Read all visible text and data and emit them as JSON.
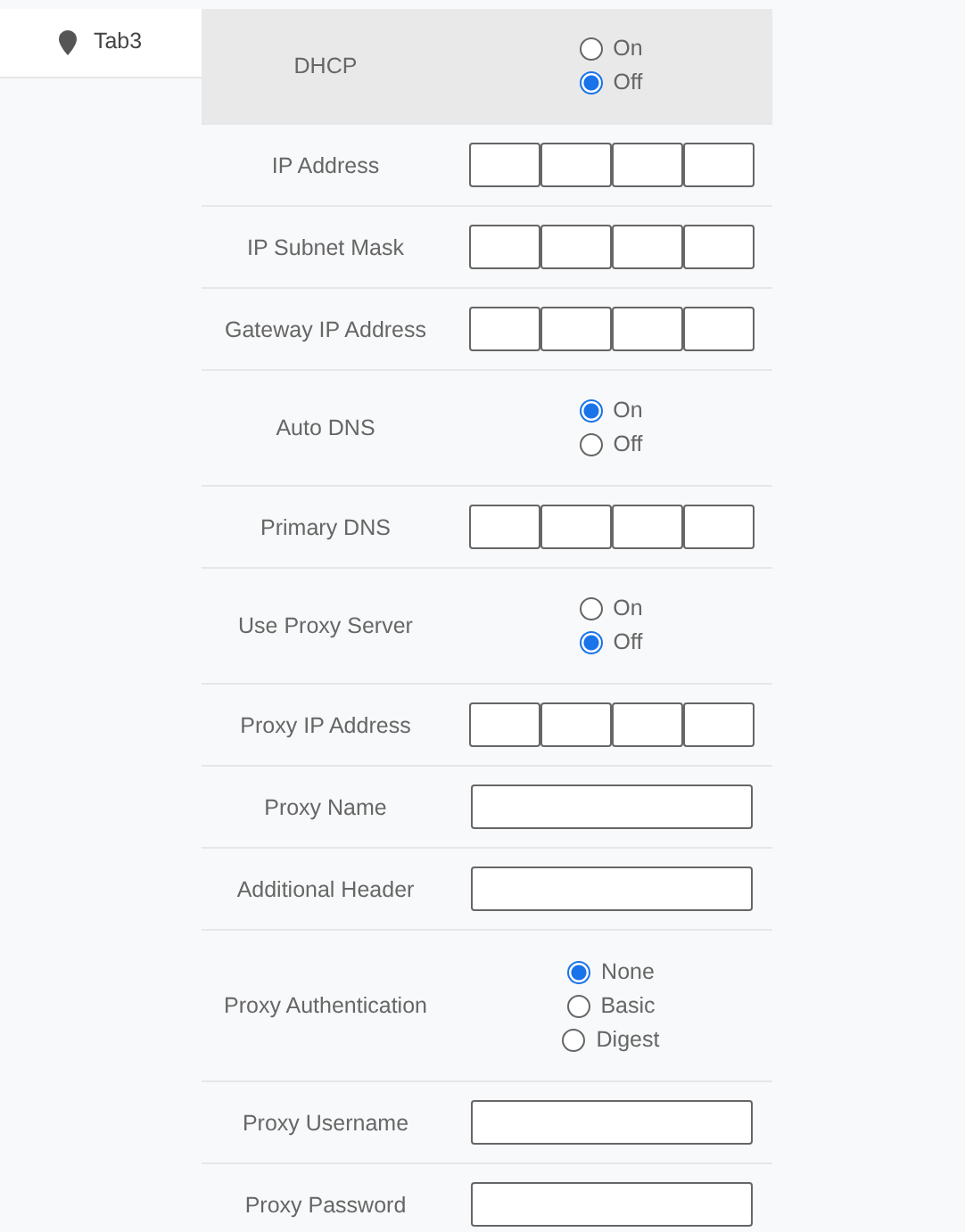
{
  "tabs": [
    {
      "label": "Tab3",
      "selected": true
    }
  ],
  "rows": [
    {
      "label": "DHCP",
      "kind": "radio",
      "highlighted": true,
      "options": [
        {
          "label": "On",
          "selected": false
        },
        {
          "label": "Off",
          "selected": true
        }
      ]
    },
    {
      "label": "IP Address",
      "kind": "ip",
      "highlighted": false
    },
    {
      "label": "IP Subnet Mask",
      "kind": "ip",
      "highlighted": false
    },
    {
      "label": "Gateway IP Address",
      "kind": "ip",
      "highlighted": false
    },
    {
      "label": "Auto DNS",
      "kind": "radio",
      "highlighted": false,
      "options": [
        {
          "label": "On",
          "selected": true
        },
        {
          "label": "Off",
          "selected": false
        }
      ]
    },
    {
      "label": "Primary DNS",
      "kind": "ip",
      "highlighted": false
    },
    {
      "label": "Use Proxy Server",
      "kind": "radio",
      "highlighted": false,
      "options": [
        {
          "label": "On",
          "selected": false
        },
        {
          "label": "Off",
          "selected": true
        }
      ]
    },
    {
      "label": "Proxy IP Address",
      "kind": "ip",
      "highlighted": false
    },
    {
      "label": "Proxy Name",
      "kind": "text",
      "highlighted": false
    },
    {
      "label": "Additional Header",
      "kind": "text",
      "highlighted": false
    },
    {
      "label": "Proxy Authentication",
      "kind": "radio",
      "highlighted": false,
      "options": [
        {
          "label": "None",
          "selected": true
        },
        {
          "label": "Basic",
          "selected": false
        },
        {
          "label": "Digest",
          "selected": false
        }
      ]
    },
    {
      "label": "Proxy Username",
      "kind": "text",
      "highlighted": false
    },
    {
      "label": "Proxy Password",
      "kind": "text",
      "highlighted": false
    }
  ]
}
